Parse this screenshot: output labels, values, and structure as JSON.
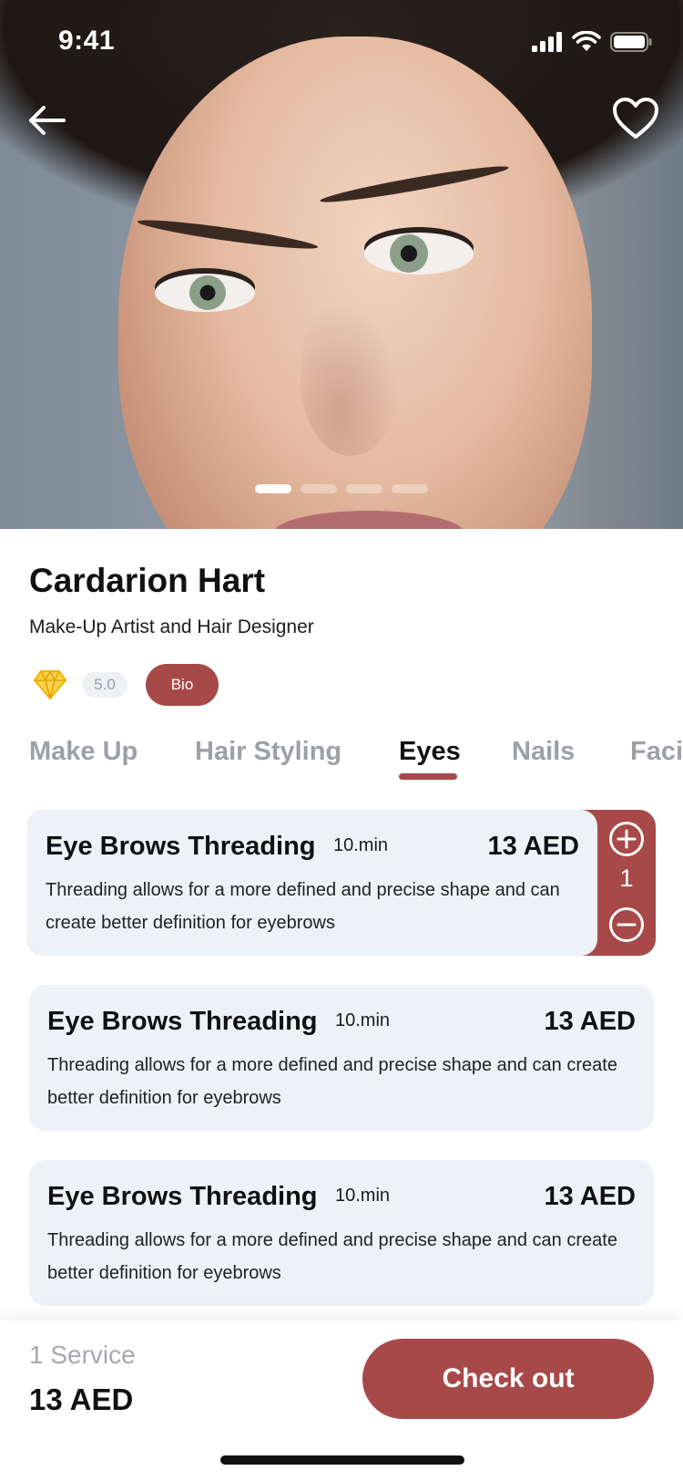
{
  "status_bar": {
    "time": "9:41",
    "icons": [
      "signal-icon",
      "wifi-icon",
      "battery-icon"
    ]
  },
  "hero": {
    "icons": [
      "back-arrow-icon",
      "heart-icon"
    ],
    "pages_total": 4,
    "active_page": 1
  },
  "profile": {
    "name": "Cardarion Hart",
    "role": "Make-Up Artist and Hair Designer",
    "rating": "5.0",
    "badge_icon": "diamond-icon",
    "bio_label": "Bio"
  },
  "tabs": [
    {
      "label": "Make Up",
      "active": false
    },
    {
      "label": "Hair Styling",
      "active": false
    },
    {
      "label": "Eyes",
      "active": true
    },
    {
      "label": "Nails",
      "active": false
    },
    {
      "label": "Facial",
      "active": false
    }
  ],
  "services": [
    {
      "title": "Eye Brows Threading",
      "duration": "10.min",
      "price": "13 AED",
      "description": "Threading allows for a more defined and precise shape and can create better definition for eyebrows",
      "quantity": "1",
      "selected": true
    },
    {
      "title": "Eye Brows Threading",
      "duration": "10.min",
      "price": "13 AED",
      "description": "Threading allows for a more defined and precise shape and can create better definition for eyebrows",
      "selected": false
    },
    {
      "title": "Eye Brows Threading",
      "duration": "10.min",
      "price": "13 AED",
      "description": "Threading allows for a more defined and precise shape and can create better definition for eyebrows",
      "selected": false
    }
  ],
  "summary": {
    "service_count": "1 Service",
    "total": "13 AED",
    "checkout_label": "Check out"
  },
  "colors": {
    "accent": "#a84949",
    "card_bg": "#eef1f6",
    "badge_gold": "#f5c518"
  }
}
